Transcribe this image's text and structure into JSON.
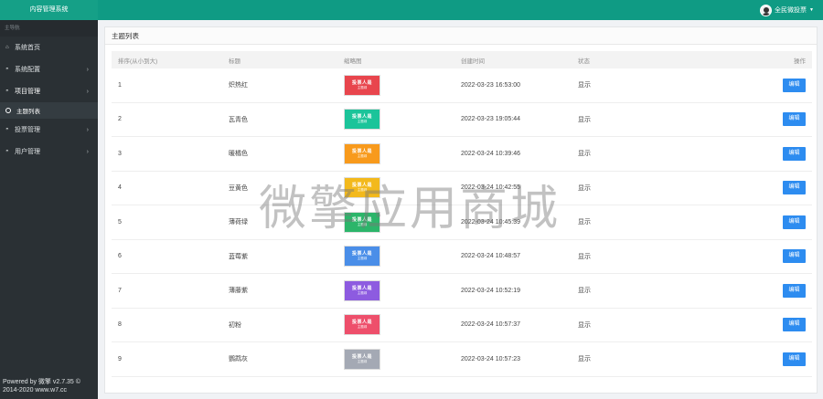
{
  "topbar": {
    "brand": "内容管理系统",
    "user_label": "全民微投票"
  },
  "sidebar": {
    "heading": "主导航",
    "items": [
      {
        "label": "系统首页",
        "icon": "home-icon",
        "glyph": "⌂",
        "arrow": ""
      },
      {
        "label": "系统配置",
        "icon": "gauge-icon",
        "glyph": "◓",
        "arrow": "›"
      },
      {
        "label": "项目管理",
        "icon": "gauge-icon",
        "glyph": "◓",
        "arrow": "›"
      },
      {
        "label": "投票管理",
        "icon": "gauge-icon",
        "glyph": "◓",
        "arrow": "›"
      },
      {
        "label": "用户管理",
        "icon": "gauge-icon",
        "glyph": "◓",
        "arrow": "›"
      }
    ],
    "active_sub": "主题列表",
    "footer_line1": "Powered by 微擎 v2.7.35 ©",
    "footer_line2": "2014-2020 www.w7.cc"
  },
  "panel": {
    "title": "主题列表"
  },
  "table": {
    "headers": [
      "排序(从小到大)",
      "标题",
      "缩略图",
      "创建时间",
      "状态",
      "操作"
    ],
    "thumb_text": "投票人是",
    "thumb_sub": "主题绿",
    "edit_label": "编辑",
    "rows": [
      {
        "order": "1",
        "title": "炽热红",
        "color": "#e8454d",
        "created": "2022-03-23 16:53:00",
        "status": "显示"
      },
      {
        "order": "2",
        "title": "瓦青色",
        "color": "#1cc49a",
        "created": "2022-03-23 19:05:44",
        "status": "显示"
      },
      {
        "order": "3",
        "title": "暖橘色",
        "color": "#f89a1c",
        "created": "2022-03-24 10:39:46",
        "status": "显示"
      },
      {
        "order": "4",
        "title": "豆黄色",
        "color": "#f3b91c",
        "created": "2022-03-24 10:42:55",
        "status": "显示"
      },
      {
        "order": "5",
        "title": "薄荷绿",
        "color": "#2cb56a",
        "created": "2022-03-24 10:45:39",
        "status": "显示"
      },
      {
        "order": "6",
        "title": "蓝莓紫",
        "color": "#4a8ee8",
        "created": "2022-03-24 10:48:57",
        "status": "显示"
      },
      {
        "order": "7",
        "title": "薄藤紫",
        "color": "#8d5be0",
        "created": "2022-03-24 10:52:19",
        "status": "显示"
      },
      {
        "order": "8",
        "title": "初粉",
        "color": "#ee4f6b",
        "created": "2022-03-24 10:57:37",
        "status": "显示"
      },
      {
        "order": "9",
        "title": "鹦鹉灰",
        "color": "#a4a9b4",
        "created": "2022-03-24 10:57:23",
        "status": "显示"
      }
    ]
  },
  "watermark": "微擎应用商城"
}
